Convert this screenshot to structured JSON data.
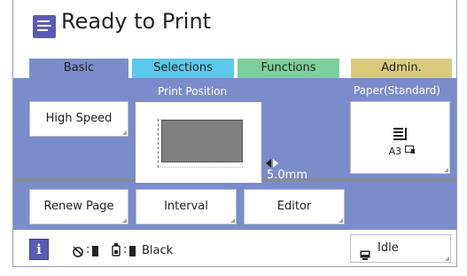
{
  "header": {
    "title": "Ready to Print"
  },
  "tabs": [
    {
      "label": "Basic",
      "color": "#7b8ccb"
    },
    {
      "label": "Selections",
      "color": "#5bc8ec"
    },
    {
      "label": "Functions",
      "color": "#7ccf9c"
    },
    {
      "label": "Admin.",
      "color": "#d8cc7c"
    }
  ],
  "basic": {
    "high_speed_label": "High Speed",
    "print_position_label": "Print Position",
    "offset_value": "5.0mm",
    "paper_label": "Paper(Standard)",
    "paper_size": "A3",
    "renew_page_label": "Renew Page",
    "interval_label": "Interval",
    "editor_label": "Editor"
  },
  "status": {
    "ink_text": "Black",
    "idle_label": "Idle"
  },
  "colors": {
    "accent": "#5b5bb4",
    "panel": "#7b8ccb"
  }
}
